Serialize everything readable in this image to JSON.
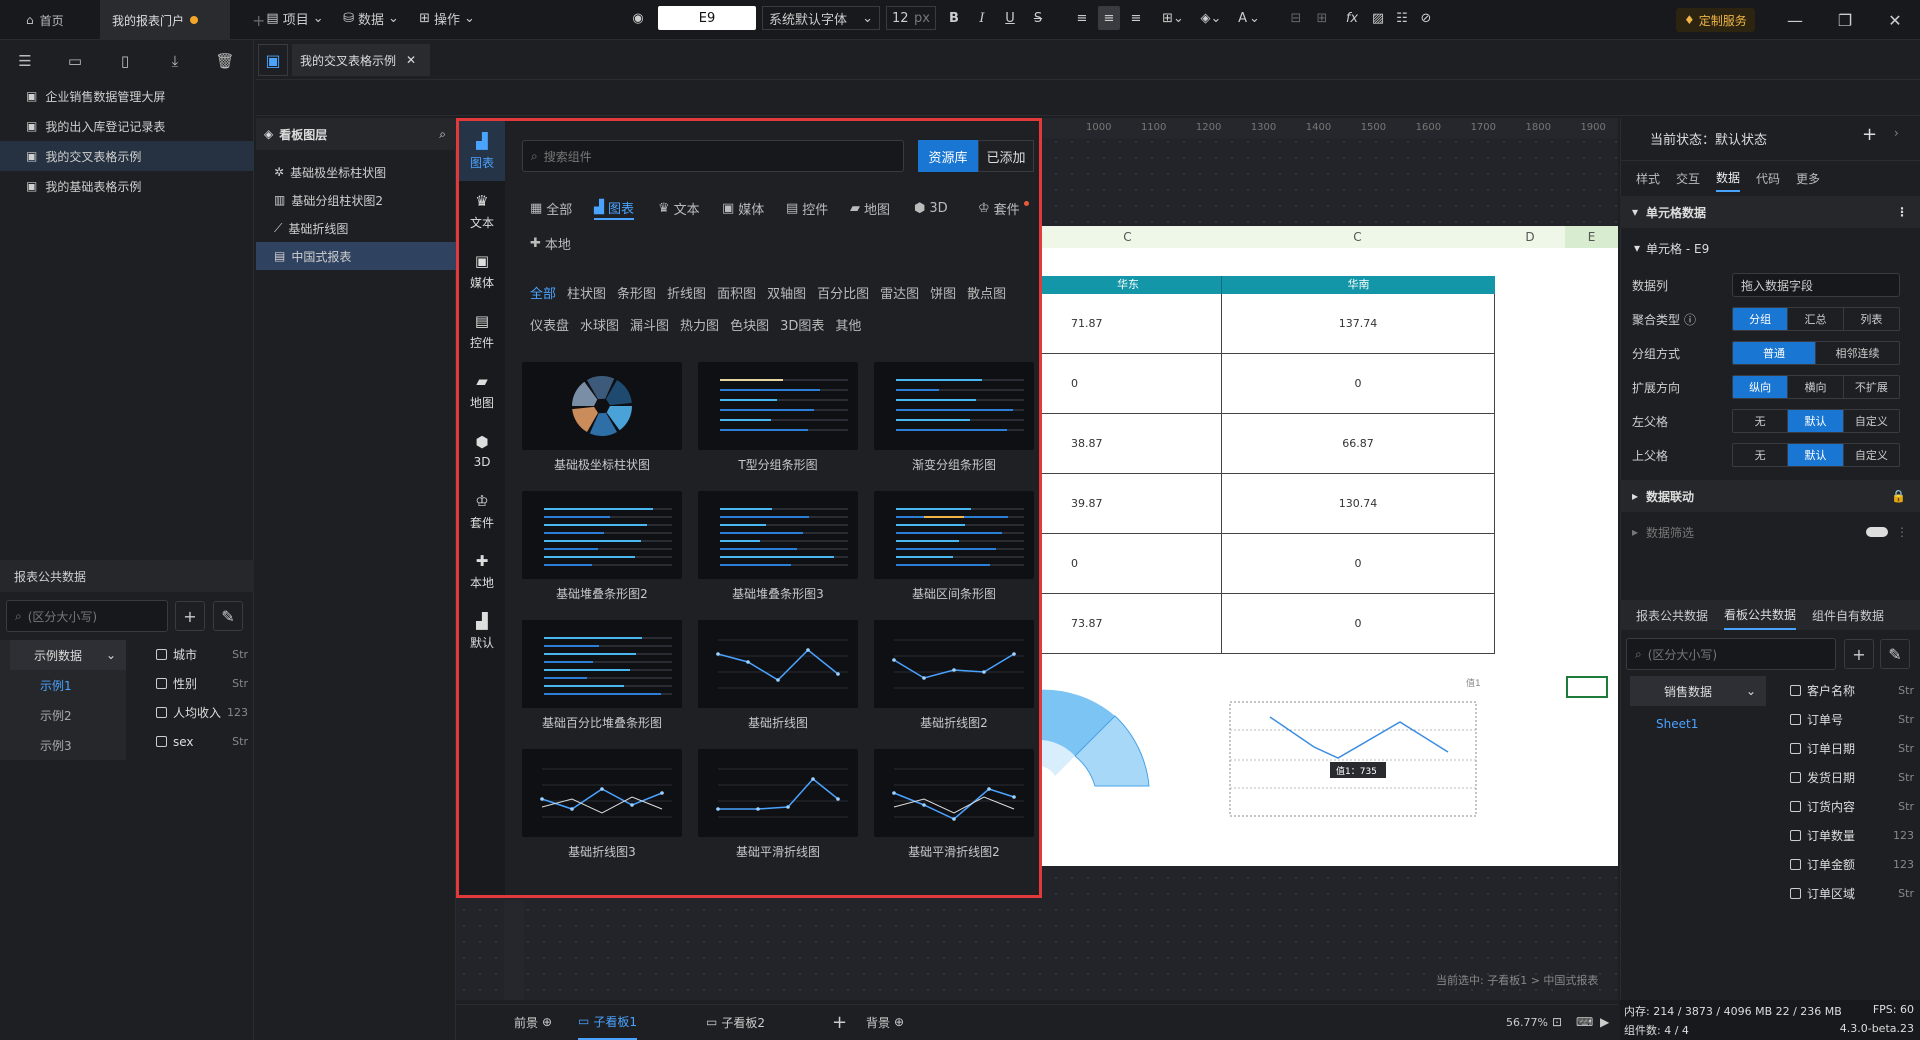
{
  "titlebar": {
    "tab_home": "首页",
    "tab_portal": "我的报表门户",
    "service": "定制服务"
  },
  "sidebar": {
    "items": [
      "企业销售数据管理大屏",
      "我的出入库登记记录表",
      "我的交叉表格示例",
      "我的基础表格示例"
    ],
    "public_data_title": "报表公共数据",
    "search_placeholder": "(区分大小写)",
    "dataset_group": "示例数据",
    "datasets": [
      "示例1",
      "示例2",
      "示例3"
    ],
    "fields": [
      {
        "name": "城市",
        "type": "Str"
      },
      {
        "name": "性别",
        "type": "Str"
      },
      {
        "name": "人均收入",
        "type": "123"
      },
      {
        "name": "sex",
        "type": "Str"
      }
    ]
  },
  "doc": {
    "tab_title": "我的交叉表格示例"
  },
  "toolbar": {
    "project": "项目",
    "data": "数据",
    "ops": "操作",
    "cell_ref": "E9",
    "font": "系统默认字体",
    "font_size": "12",
    "unit": "px",
    "bold": "B",
    "italic": "I",
    "underline": "U",
    "strike": "S",
    "text_color": "A",
    "fx": "fx"
  },
  "layers": {
    "title": "看板图层",
    "items": [
      "基础极坐标柱状图",
      "基础分组柱状图2",
      "基础折线图",
      "中国式报表"
    ]
  },
  "overlay": {
    "categories": [
      "图表",
      "文本",
      "媒体",
      "控件",
      "地图",
      "3D",
      "套件",
      "本地",
      "默认"
    ],
    "search_placeholder": "搜索组件",
    "btn_library": "资源库",
    "btn_added": "已添加",
    "filter_tabs": [
      "全部",
      "图表",
      "文本",
      "媒体",
      "控件",
      "地图",
      "3D",
      "套件",
      "本地"
    ],
    "sub_tabs": [
      "全部",
      "柱状图",
      "条形图",
      "折线图",
      "面积图",
      "双轴图",
      "百分比图",
      "雷达图",
      "饼图",
      "散点图",
      "仪表盘",
      "水球图",
      "漏斗图",
      "热力图",
      "色块图",
      "3D图表",
      "其他"
    ],
    "cards": [
      "基础极坐标柱状图",
      "T型分组条形图",
      "渐变分组条形图",
      "基础堆叠条形图2",
      "基础堆叠条形图3",
      "基础区间条形图",
      "基础百分比堆叠条形图",
      "基础折线图",
      "基础折线图2",
      "基础折线图3",
      "基础平滑折线图",
      "基础平滑折线图2"
    ]
  },
  "sheet": {
    "col_c1": "C",
    "col_c2": "C",
    "col_d": "D",
    "col_e": "E",
    "h1": "华东",
    "h2": "华南",
    "rows": [
      [
        "71.87",
        "137.74"
      ],
      [
        "0",
        "0"
      ],
      [
        "38.87",
        "66.87"
      ],
      [
        "39.87",
        "130.74"
      ],
      [
        "0",
        "0"
      ],
      [
        "73.87",
        "0"
      ]
    ],
    "tooltip": "值1：735",
    "legend": "值1"
  },
  "ruler": [
    "1000",
    "1100",
    "1200",
    "1300",
    "1400",
    "1500",
    "1600",
    "1700",
    "1800",
    "1900"
  ],
  "right": {
    "state": "当前状态：默认状态",
    "tabs": [
      "样式",
      "交互",
      "数据",
      "代码",
      "更多"
    ],
    "cell_data": "单元格数据",
    "cell": "单元格 - E9",
    "data_col": "数据列",
    "data_col_placeholder": "拖入数据字段",
    "agg_label": "聚合类型",
    "agg": [
      "分组",
      "汇总",
      "列表"
    ],
    "group_label": "分组方式",
    "group": [
      "普通",
      "相邻连续"
    ],
    "expand_label": "扩展方向",
    "expand": [
      "纵向",
      "横向",
      "不扩展"
    ],
    "left_parent": "左父格",
    "left_opts": [
      "无",
      "默认",
      "自定义"
    ],
    "top_parent": "上父格",
    "top_opts": [
      "无",
      "默认",
      "自定义"
    ],
    "linkage": "数据联动",
    "filter": "数据筛选",
    "data_tabs": [
      "报表公共数据",
      "看板公共数据",
      "组件自有数据"
    ],
    "search_placeholder": "(区分大小写)",
    "dataset": "销售数据",
    "sheet": "Sheet1",
    "fields": [
      {
        "name": "客户名称",
        "type": "Str"
      },
      {
        "name": "订单号",
        "type": "Str"
      },
      {
        "name": "订单日期",
        "type": "Str"
      },
      {
        "name": "发货日期",
        "type": "Str"
      },
      {
        "name": "订货内容",
        "type": "Str"
      },
      {
        "name": "订单数量",
        "type": "123"
      },
      {
        "name": "订单金额",
        "type": "123"
      },
      {
        "name": "订单区域",
        "type": "Str"
      }
    ]
  },
  "status": {
    "tabs": [
      "前景",
      "子看板1",
      "子看板2",
      "背景"
    ],
    "zoom": "56.77%",
    "selected": "当前选中: 子看板1 > 中国式报表",
    "memory": "内存: 214 / 3873 / 4096 MB  22 / 236 MB",
    "fps": "FPS: 60",
    "components": "组件数: 4 / 4",
    "version": "4.3.0-beta.23"
  }
}
